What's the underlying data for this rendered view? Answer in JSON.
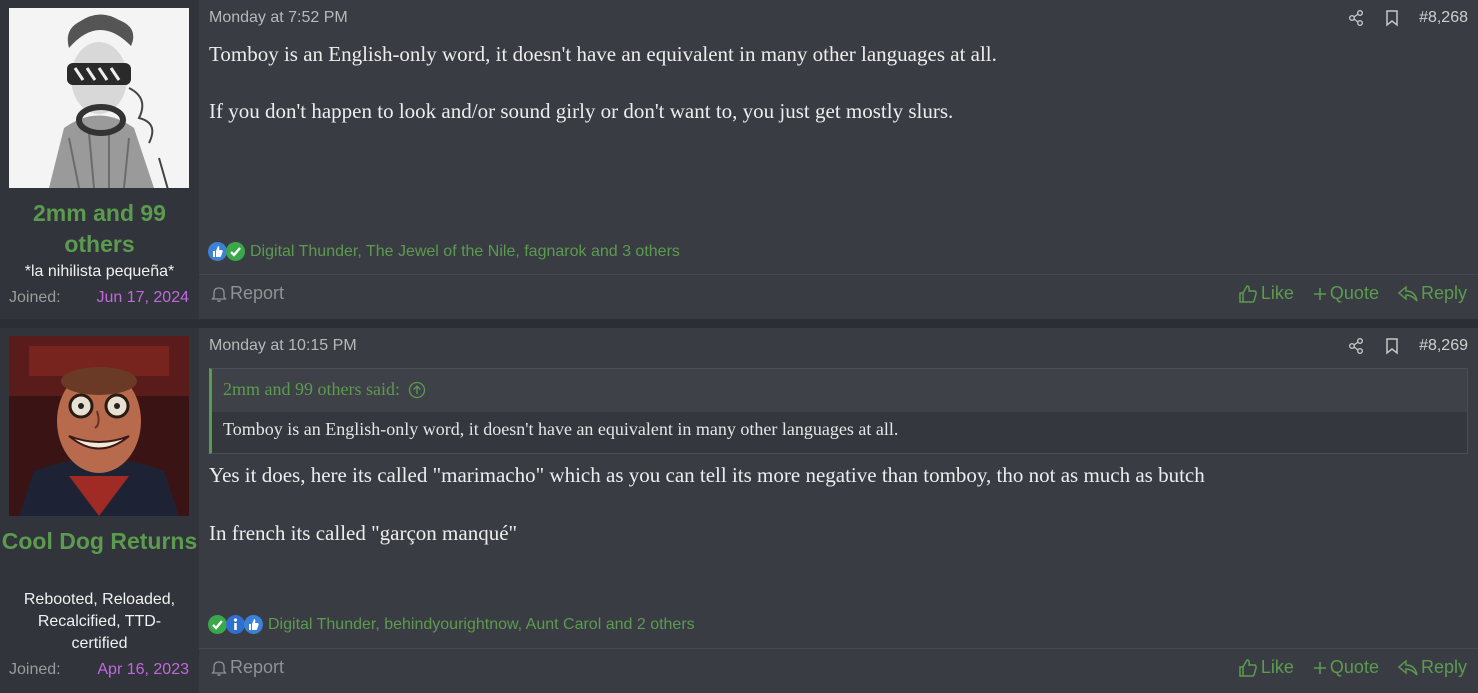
{
  "posts": [
    {
      "author": {
        "name": "2mm and 99 others",
        "title": "*la nihilista pequeña*",
        "joined_label": "Joined:",
        "joined_date": "Jun 17, 2024"
      },
      "timestamp": "Monday at 7:52 PM",
      "post_number": "#8,268",
      "message": [
        "Tomboy is an English-only word, it doesn't have an equivalent in many other languages at all.",
        "If you don't happen to look and/or sound girly or don't want to, you just get mostly slurs."
      ],
      "reactions": {
        "icons": [
          "like-icon",
          "agree-icon"
        ],
        "text": "Digital Thunder, The Jewel of the Nile, fagnarok and 3 others"
      },
      "footer": {
        "report": "Report",
        "like": "Like",
        "quote": "Quote",
        "reply": "Reply"
      }
    },
    {
      "author": {
        "name": "Cool Dog Returns",
        "title": "Rebooted, Reloaded, Recalcified, TTD-certified",
        "joined_label": "Joined:",
        "joined_date": "Apr 16, 2023"
      },
      "timestamp": "Monday at 10:15 PM",
      "post_number": "#8,269",
      "quote": {
        "attribution": "2mm and 99 others said:",
        "text": "Tomboy is an English-only word, it doesn't have an equivalent in many other languages at all."
      },
      "message": [
        "Yes it does, here its called \"marimacho\" which as you can tell its more negative than tomboy, tho not as much as butch",
        "In french its called \"garçon manqué\""
      ],
      "reactions": {
        "icons": [
          "agree-icon",
          "informative-icon",
          "like-icon"
        ],
        "text": "Digital Thunder, behindyourightnow, Aunt Carol and 2 others"
      },
      "footer": {
        "report": "Report",
        "like": "Like",
        "quote": "Quote",
        "reply": "Reply"
      }
    }
  ],
  "colors": {
    "background": "#393c43",
    "sidebar": "#31343a",
    "accent_green": "#5c9b4f",
    "joined_date": "#c268de"
  }
}
